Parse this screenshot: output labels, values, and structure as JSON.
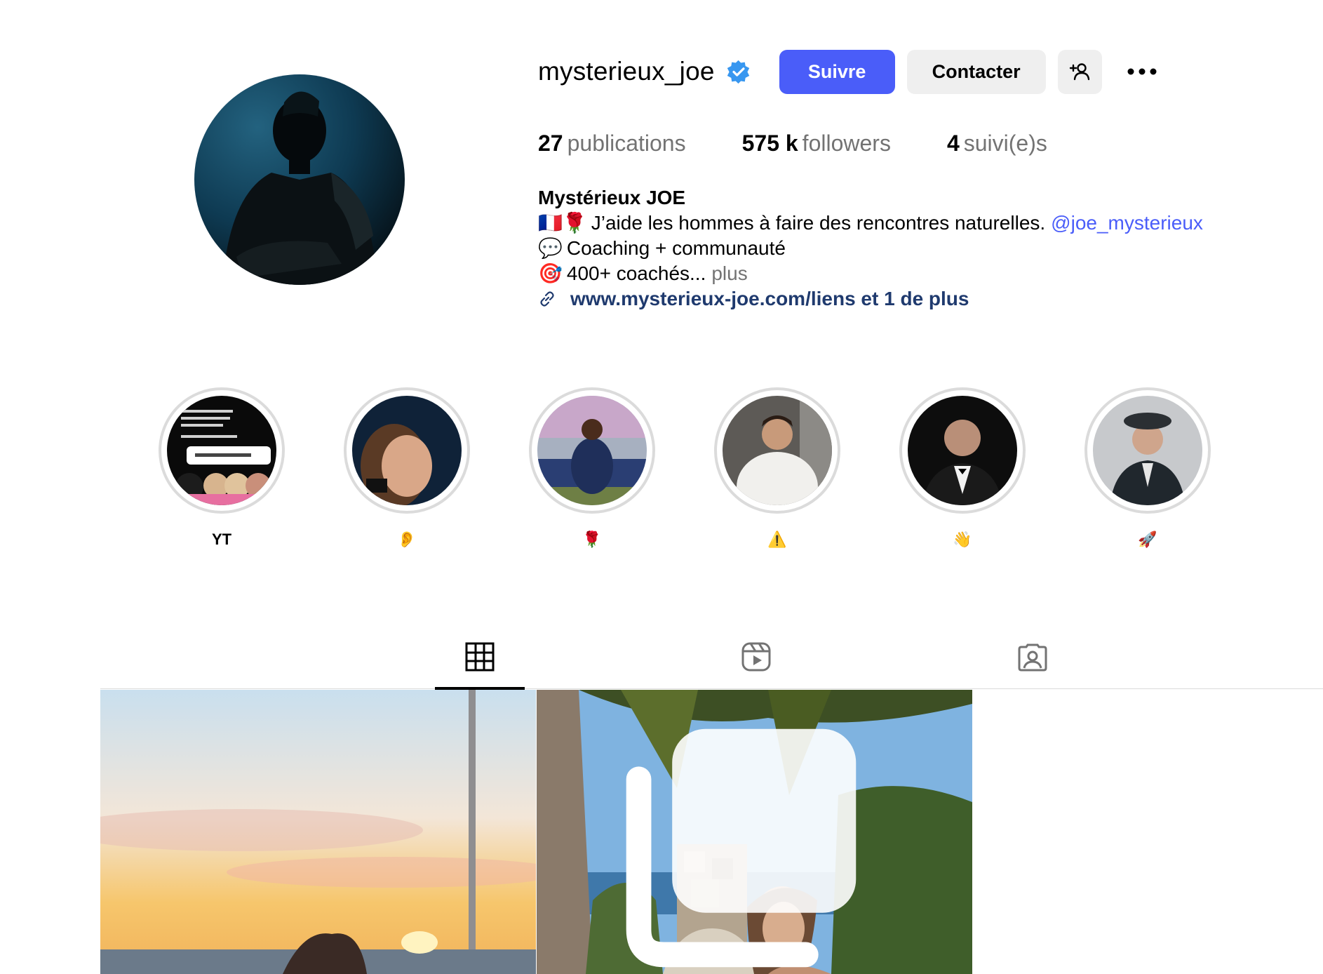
{
  "profile": {
    "username": "mysterieux_joe",
    "display_name": "Mystérieux JOE",
    "follow_label": "Suivre",
    "contact_label": "Contacter",
    "stats": {
      "posts_count": "27",
      "posts_label": "publications",
      "followers_count": "575 k",
      "followers_label": "followers",
      "following_count": "4",
      "following_label": "suivi(e)s"
    },
    "bio": {
      "line1_emoji": "🇫🇷🌹",
      "line1_text": "J’aide les hommes à faire des rencontres naturelles.",
      "line1_mention": "@joe_mysterieux",
      "line2_emoji": "💬",
      "line2_text": "Coaching + communauté",
      "line3_emoji": "🎯",
      "line3_text": "400+ coachés...",
      "line3_more": "plus",
      "link_text": "www.mysterieux-joe.com/liens et 1 de plus"
    }
  },
  "highlights": [
    {
      "label": "YT"
    },
    {
      "label": "👂"
    },
    {
      "label": "🌹"
    },
    {
      "label": "⚠️"
    },
    {
      "label": "👋"
    },
    {
      "label": "🚀"
    }
  ],
  "colors": {
    "accent": "#4a5df9",
    "secondary_button": "#efefef",
    "muted_text": "#737373",
    "link_dark": "#1f3a6e",
    "divider": "#dbdbdb"
  },
  "icons": {
    "verified": "verified-badge-icon",
    "add_user": "add-user-icon",
    "more": "more-dots-icon",
    "link": "link-icon",
    "posts_tab": "grid-icon",
    "reels_tab": "reels-icon",
    "tagged_tab": "tagged-icon",
    "carousel": "carousel-icon"
  }
}
